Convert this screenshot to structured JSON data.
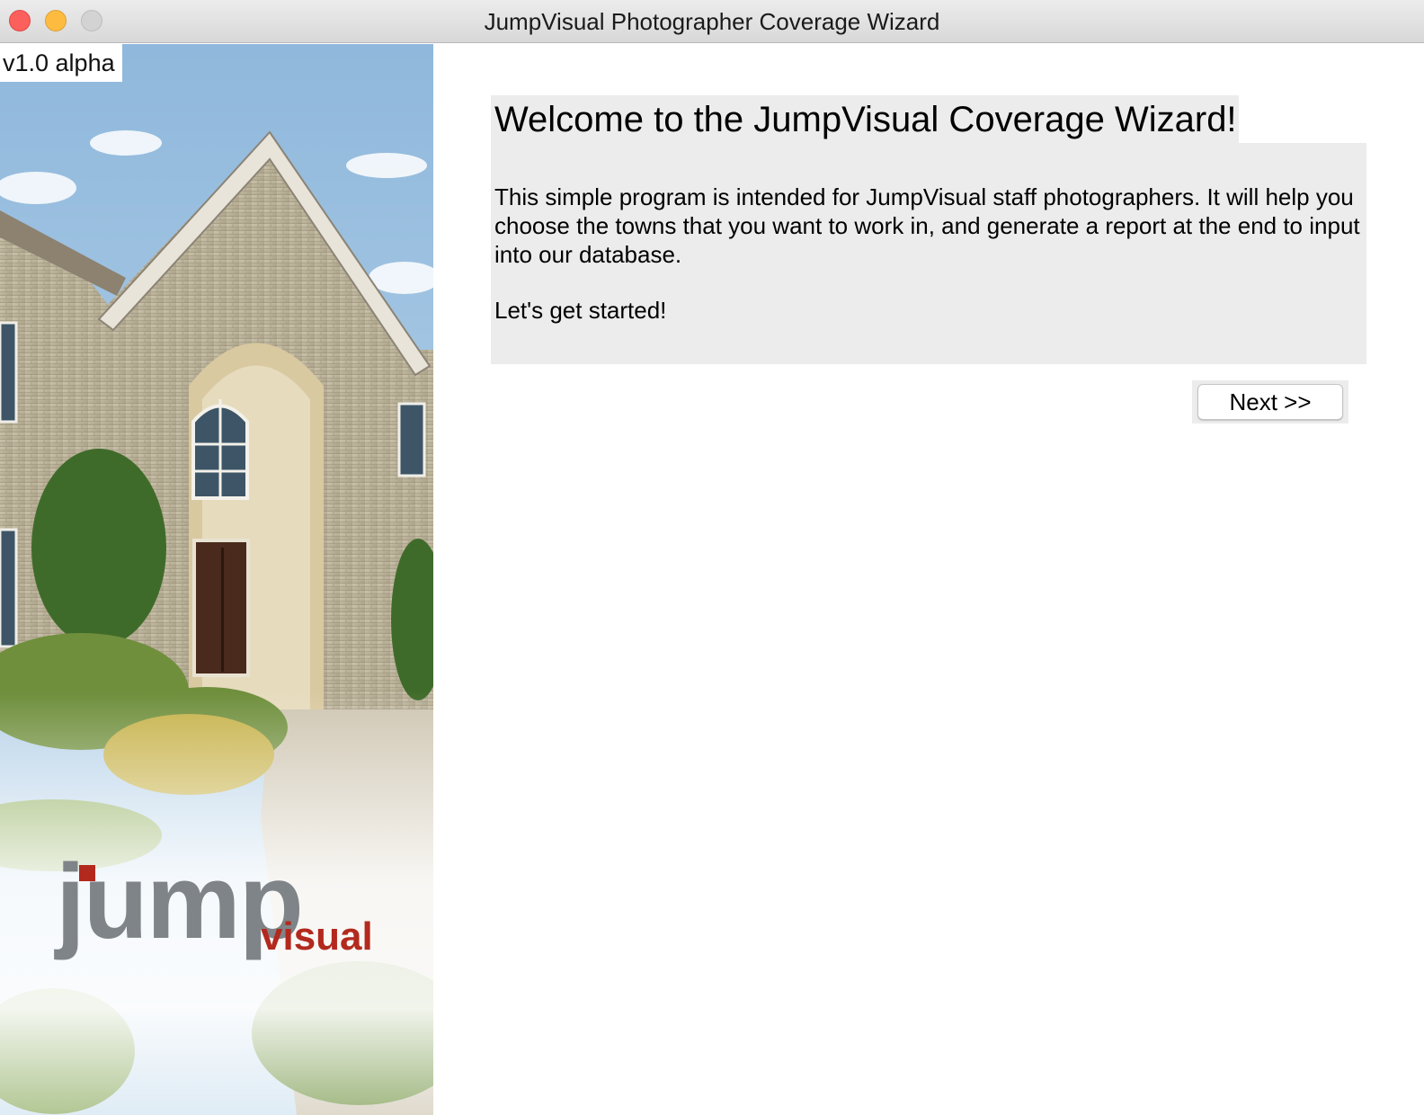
{
  "window": {
    "title": "JumpVisual Photographer Coverage Wizard",
    "controls": [
      "close",
      "minimize",
      "zoom"
    ]
  },
  "splash": {
    "version": "v1.0 alpha",
    "image": "house-exterior-photo",
    "logo": {
      "primary": "jump",
      "secondary": "visual",
      "primary_color": "#7f8488",
      "accent_color": "#b3291e"
    }
  },
  "content": {
    "heading": "Welcome to the JumpVisual Coverage Wizard!",
    "intro": "This simple program is intended for JumpVisual staff photographers. It will help you choose the towns that you want to work in, and generate a report at the end to input into our database.",
    "call_to_action": "Let's get started!",
    "next_label": "Next >>"
  },
  "colors": {
    "panel_background": "#ececec",
    "close": "#fc605c",
    "minimize": "#fdbc40",
    "zoom": "#d3d3d3"
  }
}
